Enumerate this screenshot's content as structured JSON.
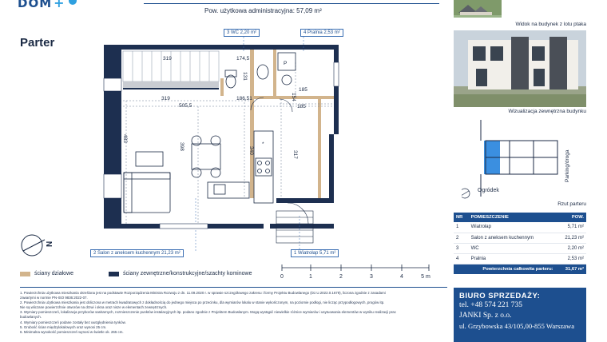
{
  "header": {
    "logo_text": "DOM",
    "logo_plus": "+",
    "usable_area": "Pow. użytkowa administracyjna: 57,09 m²"
  },
  "floor": {
    "title": "Parter"
  },
  "plan_labels": {
    "wc": "3 WC 2,20 m²",
    "pralnia": "4 Pralnia 2,53 m²",
    "salon": "2 Salon z aneksem kuchennym 21,23 m²",
    "wiatrolap": "1 Wiatrołap 5,71 m²"
  },
  "dimensions": {
    "d_319_top": "319",
    "d_174_5": "174,5",
    "d_131": "131",
    "d_185": "185",
    "d_154": "154",
    "d_319": "319",
    "d_186_51": "186,51",
    "d_505_5": "505,5",
    "d_185b": "185",
    "d_483": "483",
    "d_398": "398",
    "d_340": "340",
    "d_317": "317",
    "parking_p": "P"
  },
  "scale_bar": {
    "ticks": [
      "0",
      "1",
      "2",
      "3",
      "4",
      "5 m"
    ]
  },
  "compass": {
    "letter": "N"
  },
  "legend": {
    "partition_walls": "ściany działowe",
    "outer_walls": "ściany zewnętrzne/konstrukcyjne/szachty kominowe",
    "colors": {
      "partition": "#d2b48c",
      "outer": "#1d2f50"
    }
  },
  "notes": [
    "1. Powierzchnia użytkowa mieszkania określona jest na podstawie Rozporządzenia Ministra Rozwoju z dn. 11.09.2020 r. w sprawie szczegółowego zakresu i formy Projektu Budowlanego (Dz.U.2022.0.1679), liczona zgodnie z zasadami",
    "zawartymi w normie PN-ISO 9836:2022-07.",
    "2. Powierzchnia użytkowa mieszkania jest obliczona w metrach kwadratowych z dokładnością do jednego miejsca po przecinku, dla wymiarów lokalu w stanie wykończonym, na poziomie podłogi, nie licząc przypodłogowych, progów itp.",
    "Nie są wliczane powierzchnie otworów na drzwi i okna oraz nisze w elementach zewnętrznych.",
    "3. Wymiary pomieszczeń, lokalizacja przyborów sanitarnych, rozmieszczenie punktów instalacyjnych itp. podano zgodnie z Projektem Budowlanym. Mogą wystąpić niewielkie różnice wymiarów i usytuowania elementów w wyniku realizacji prac",
    "budowlanych.",
    "4. Wymiary pomieszczeń podane zostały bez uwzględnienia tynków.",
    "5. Grubość ścian międzylokalowych oraz wynosi 25 cm.",
    "6. Minimalna wysokość pomieszczeń wynosi w świetle ok. 265 cm."
  ],
  "right": {
    "photo_top_caption": "Widok na budynek z lotu ptaka",
    "photo_building_caption": "Wizualizacja zewnętrzna budynku",
    "site_labels": {
      "parking": "Parking/droga",
      "garden": "Ogródek"
    },
    "site_caption": "Rzut parteru"
  },
  "rooms_table": {
    "headers": [
      "NR",
      "POMIESZCZENIE",
      "POW."
    ],
    "rows": [
      {
        "nr": "1",
        "name": "Wiatrołap",
        "area": "5,71 m²"
      },
      {
        "nr": "2",
        "name": "Salon z aneksem kuchennym",
        "area": "21,23 m²"
      },
      {
        "nr": "3",
        "name": "WC",
        "area": "2,20 m²"
      },
      {
        "nr": "4",
        "name": "Pralnia",
        "area": "2,53 m²"
      }
    ],
    "total_label": "Powierzchnia całkowita parteru:",
    "total_value": "31,67 m²"
  },
  "sales": {
    "title": "BIURO SPRZEDAŻY:",
    "phone": "tel. +48 574 221 735",
    "company": "JANKI Sp. z o.o.",
    "address": "ul. Grzybowska 43/105,00-855 Warszawa"
  }
}
